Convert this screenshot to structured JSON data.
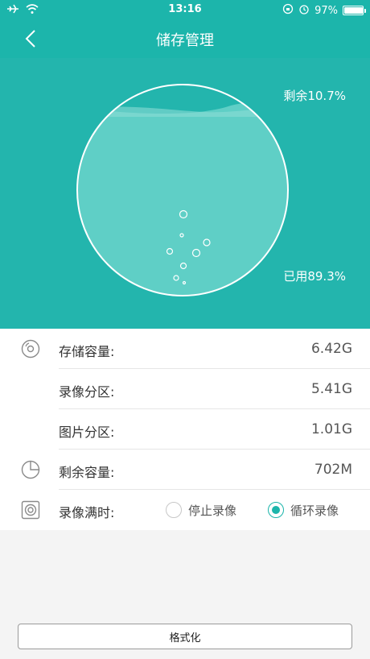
{
  "status_bar": {
    "time": "13:16",
    "battery_text": "97%",
    "battery_level": 0.97,
    "icons": [
      "airplane-icon",
      "wifi-icon",
      "orientation-lock-icon",
      "alarm-icon",
      "battery-icon"
    ]
  },
  "nav": {
    "title": "储存管理",
    "back_icon": "chevron-left-icon"
  },
  "storage_visual": {
    "remaining_label": "剩余10.7%",
    "used_label": "已用89.3%",
    "used_fraction": 0.893,
    "colors": {
      "background": "#23b5ad",
      "liquid": "#5fcfc6",
      "circle_stroke": "#ffffff"
    }
  },
  "details": {
    "capacity": {
      "label": "存储容量:",
      "value": "6.42G",
      "icon": "disc-icon"
    },
    "video_partition": {
      "label": "录像分区:",
      "value": "5.41G"
    },
    "image_partition": {
      "label": "图片分区:",
      "value": "1.01G"
    },
    "remaining": {
      "label": "剩余容量:",
      "value": "702M",
      "icon": "pie-chart-icon"
    },
    "when_full": {
      "label": "录像满时:",
      "icon": "speaker-icon",
      "options": [
        {
          "label": "停止录像",
          "selected": false
        },
        {
          "label": "循环录像",
          "selected": true
        }
      ]
    }
  },
  "format_button": {
    "label": "格式化"
  },
  "accent_color": "#1cb5ab"
}
